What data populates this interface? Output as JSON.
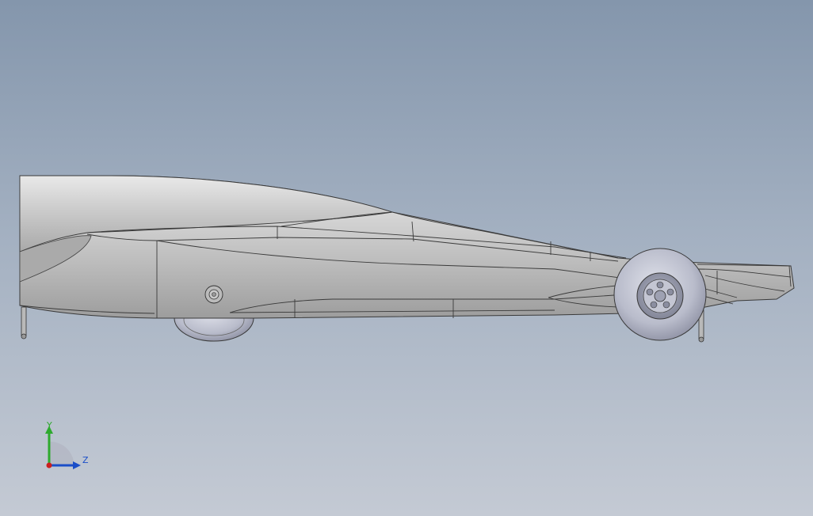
{
  "viewport": {
    "background_top": "#8496ac",
    "background_bottom": "#c4cad4",
    "model": "race-car-side-view",
    "model_color": "#c6c6c6",
    "edge_color": "#3a3a3a"
  },
  "triad": {
    "y_label": "Y",
    "z_label": "Z",
    "y_color": "#2eaa2e",
    "z_color": "#1a4ec8",
    "origin_color": "#cc1f1f"
  }
}
